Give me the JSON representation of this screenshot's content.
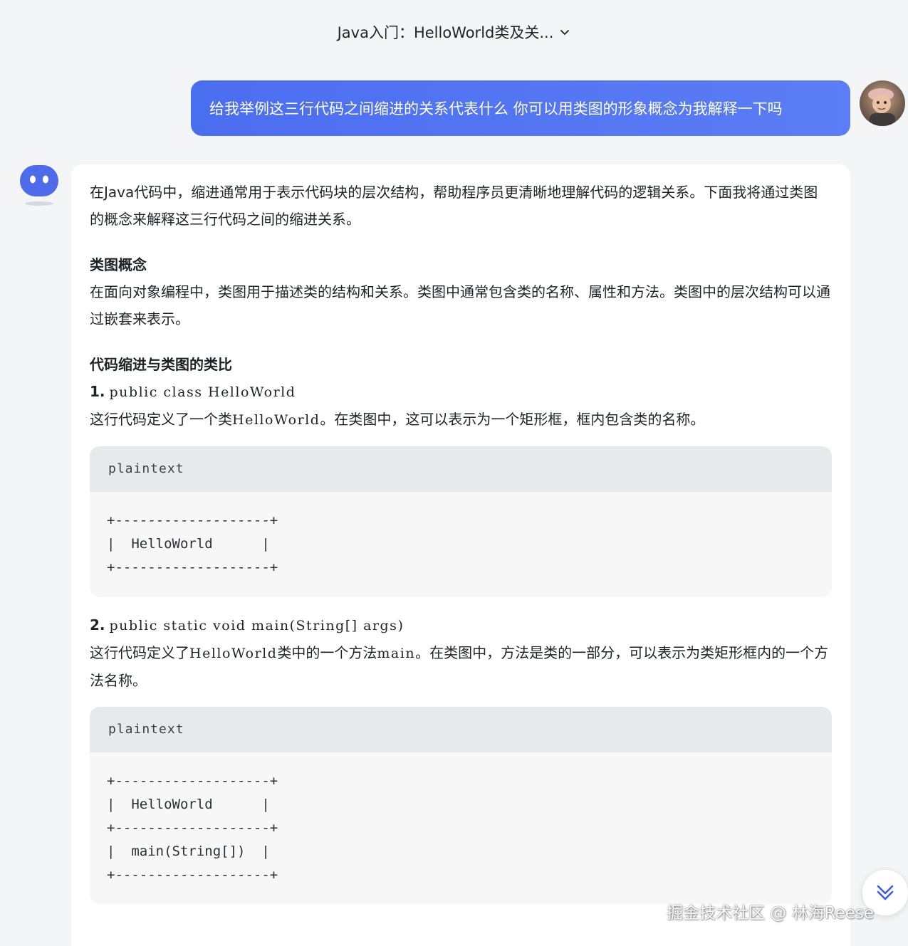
{
  "header": {
    "conversation_title": "Java入门：HelloWorld类及关..."
  },
  "user_message": {
    "text": "给我举例这三行代码之间缩进的关系代表什么 你可以用类图的形象概念为我解释一下吗"
  },
  "answer": {
    "intro": "在Java代码中，缩进通常用于表示代码块的层次结构，帮助程序员更清晰地理解代码的逻辑关系。下面我将通过类图的概念来解释这三行代码之间的缩进关系。",
    "heading1": "类图概念",
    "para1": "在面向对象编程中，类图用于描述类的结构和关系。类图中通常包含类的名称、属性和方法。类图中的层次结构可以通过嵌套来表示。",
    "heading2": "代码缩进与类图的类比",
    "step1": {
      "num": "1.",
      "code": "public class HelloWorld"
    },
    "desc1": {
      "a": "这行代码定义了一个类",
      "code": "HelloWorld",
      "b": "。在类图中，这可以表示为一个矩形框，框内包含类的名称。"
    },
    "block1": {
      "lang": "plaintext",
      "code": "+-------------------+\n|  HelloWorld      |\n+-------------------+"
    },
    "step2": {
      "num": "2.",
      "code": "public static void main(String[] args)"
    },
    "desc2": {
      "a": "这行代码定义了",
      "code1": "HelloWorld",
      "b": "类中的一个方法",
      "code2": "main",
      "c": "。在类图中，方法是类的一部分，可以表示为类矩形框内的一个方法名称。"
    },
    "block2": {
      "lang": "plaintext",
      "code": "+-------------------+\n|  HelloWorld      |\n+-------------------+\n|  main(String[])  |\n+-------------------+"
    }
  },
  "watermark": "掘金技术社区 @ 林海Reese",
  "colors": {
    "accent": "#4a6ef0",
    "bot_avatar": "#4d6bea",
    "page_bg": "#f4f5f7"
  },
  "icons": {
    "title_dropdown": "chevron-down-icon",
    "scroll_bottom": "double-chevron-down-icon",
    "bot": "bot-avatar-icon"
  }
}
